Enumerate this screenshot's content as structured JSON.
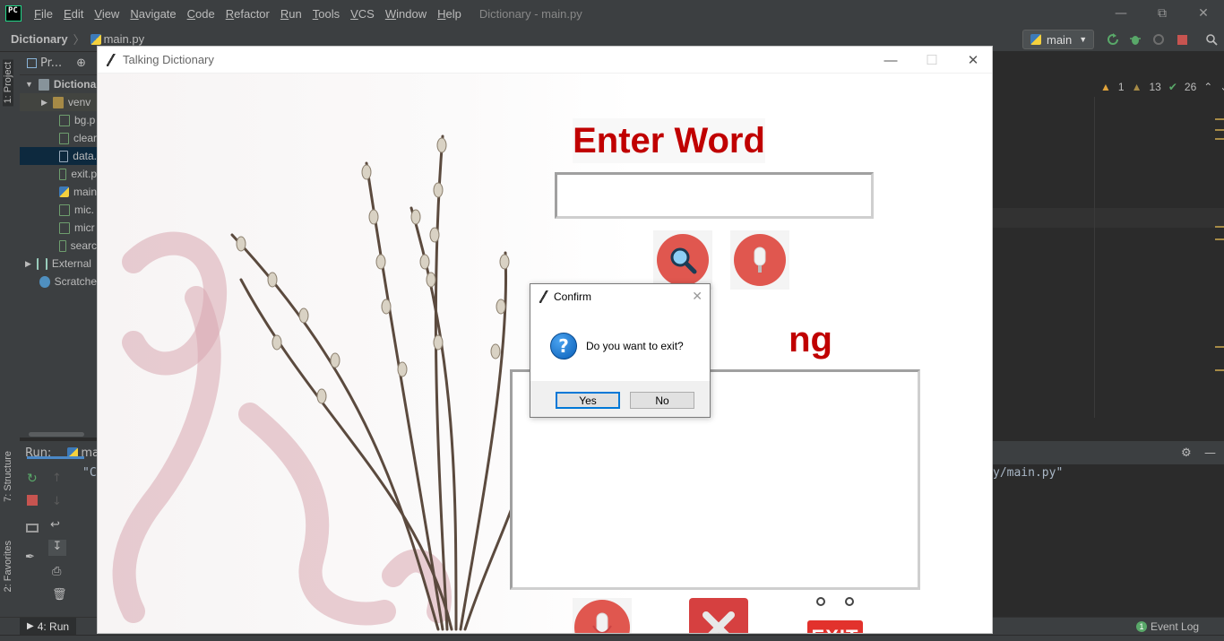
{
  "ide": {
    "logo": "PC",
    "menu": [
      "File",
      "Edit",
      "View",
      "Navigate",
      "Code",
      "Refactor",
      "Run",
      "Tools",
      "VCS",
      "Window",
      "Help"
    ],
    "title": "Dictionary - main.py",
    "breadcrumb": {
      "project": "Dictionary",
      "file": "main.py"
    },
    "run_config": "main",
    "inspections": {
      "warnings": "1",
      "weak_warnings": "13",
      "ok": "26"
    },
    "left_tabs": {
      "project": "1: Project",
      "structure": "7: Structure",
      "favorites": "2: Favorites"
    },
    "project_panel": {
      "header": "Pr...",
      "items": [
        {
          "label": "Dictiona",
          "icon": "folder-icon"
        },
        {
          "label": "venv",
          "icon": "folder-icon"
        },
        {
          "label": "bg.p",
          "icon": "image-file-icon"
        },
        {
          "label": "clear",
          "icon": "image-file-icon"
        },
        {
          "label": "data.",
          "icon": "json-file-icon"
        },
        {
          "label": "exit.p",
          "icon": "image-file-icon"
        },
        {
          "label": "main",
          "icon": "python-file-icon"
        },
        {
          "label": "mic.",
          "icon": "image-file-icon"
        },
        {
          "label": "micr",
          "icon": "image-file-icon"
        },
        {
          "label": "searc",
          "icon": "image-file-icon"
        },
        {
          "label": "External",
          "icon": "library-icon"
        },
        {
          "label": "Scratche",
          "icon": "scratch-icon"
        }
      ]
    },
    "run_panel": {
      "label": "Run:",
      "tab": "ma",
      "console_left": "\"C",
      "console_right": "y/main.py\""
    },
    "bottom_tabs": {
      "run": "4: Run",
      "event_log": "Event Log",
      "event_count": "1"
    }
  },
  "app": {
    "title": "Talking Dictionary",
    "enter_word_heading": "Enter Word",
    "meaning_heading_visible": "ng",
    "word_entry_value": "",
    "meaning_text": "",
    "colors": {
      "heading": "#c00000",
      "button": "#e0574f",
      "exit": "#e2322c"
    }
  },
  "dialog": {
    "title": "Confirm",
    "message": "Do you want to exit?",
    "yes_label": "Yes",
    "no_label": "No",
    "icon": "question-icon"
  }
}
